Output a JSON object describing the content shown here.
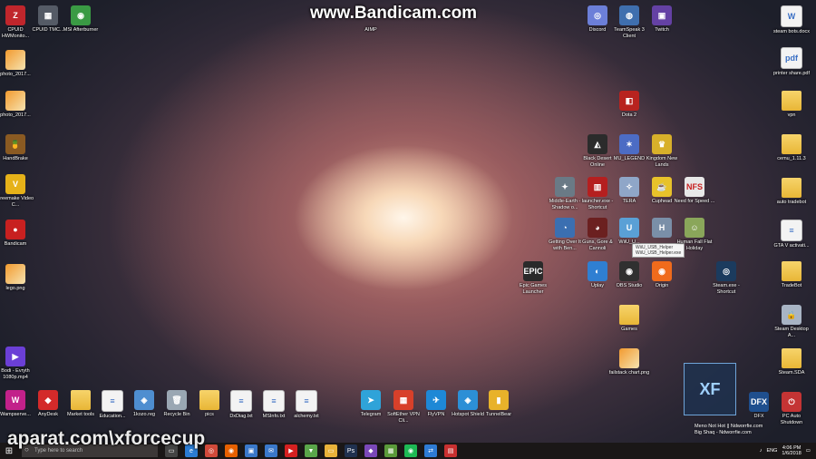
{
  "watermarks": {
    "bandicam": "www.Bandicam.com",
    "aparat": "aparat.com\\xforcecup",
    "xf": "XF"
  },
  "tooltip": {
    "line1": "WiiU_USB_Helper",
    "line2": "WiiU_USB_Helper.exe"
  },
  "desktop_icons": [
    {
      "label": "CPUID HWMonito...",
      "glyph": "Z",
      "color": "#c0262c"
    },
    {
      "label": "CPUID TMC...",
      "glyph": "▦",
      "color": "#555b66"
    },
    {
      "label": "MSI Afterburner",
      "glyph": "◉",
      "color": "#3a9a44"
    },
    {
      "label": "photo_2017...",
      "glyph": "",
      "color": "img"
    },
    {
      "label": "photo_2017...",
      "glyph": "",
      "color": "img"
    },
    {
      "label": "HandBrake",
      "glyph": "🍍",
      "color": "#8a5a22"
    },
    {
      "label": "Freemake Video C...",
      "glyph": "V",
      "color": "#e6b219"
    },
    {
      "label": "Bandicam",
      "glyph": "●",
      "color": "#c82020"
    },
    {
      "label": "lego.png",
      "glyph": "",
      "color": "img"
    },
    {
      "label": "Bodi - Evryth 1080p.mp4",
      "glyph": "▶",
      "color": "#6b3fd6"
    },
    {
      "label": "Wampserve...",
      "glyph": "W",
      "color": "#c2218a"
    },
    {
      "label": "AnyDesk",
      "glyph": "◆",
      "color": "#d32a2a"
    },
    {
      "label": "Market tools",
      "glyph": "",
      "color": "folder"
    },
    {
      "label": "Education...",
      "glyph": "≡",
      "color": "doc"
    },
    {
      "label": "1kozo.reg",
      "glyph": "◈",
      "color": "#4e8ed0"
    },
    {
      "label": "Recycle Bin",
      "glyph": "🗑",
      "color": "#9aa7b3"
    },
    {
      "label": "pics",
      "glyph": "",
      "color": "folder"
    },
    {
      "label": "DxDiag.txt",
      "glyph": "≡",
      "color": "doc"
    },
    {
      "label": "MSInfo.txt",
      "glyph": "≡",
      "color": "doc"
    },
    {
      "label": "alchemy.txt",
      "glyph": "≡",
      "color": "doc"
    },
    {
      "label": "AIMP",
      "glyph": "",
      "color": "none"
    },
    {
      "label": "Telegram",
      "glyph": "➤",
      "color": "#2fa3d9"
    },
    {
      "label": "SoftEther VPN Cli...",
      "glyph": "▦",
      "color": "#d8402a"
    },
    {
      "label": "FlyVPN",
      "glyph": "✈",
      "color": "#1e88d6"
    },
    {
      "label": "Hotspot Shield",
      "glyph": "◈",
      "color": "#2c8fd6"
    },
    {
      "label": "TunnelBear",
      "glyph": "▮",
      "color": "#e8b22a"
    },
    {
      "label": "Discord",
      "glyph": "◎",
      "color": "#6c7fd8"
    },
    {
      "label": "TeamSpeak 3 Client",
      "glyph": "◍",
      "color": "#3f6fae"
    },
    {
      "label": "Twitch",
      "glyph": "▣",
      "color": "#6441a4"
    },
    {
      "label": "Dota 2",
      "glyph": "◧",
      "color": "#b8231f"
    },
    {
      "label": "Black Desert Online",
      "glyph": "◭",
      "color": "#2b2b2b"
    },
    {
      "label": "MU_LEGEND",
      "glyph": "✶",
      "color": "#4c6cc4"
    },
    {
      "label": "Kingdom New Lands",
      "glyph": "♛",
      "color": "#d8b02a"
    },
    {
      "label": "Middle-Earth - Shadow o...",
      "glyph": "✦",
      "color": "#6a7a86"
    },
    {
      "label": "launcher.exe - Shortcut",
      "glyph": "▥",
      "color": "#b51f1f"
    },
    {
      "label": "TERA",
      "glyph": "✧",
      "color": "#8fa6c8"
    },
    {
      "label": "Cuphead",
      "glyph": "☕",
      "color": "#e8c22a"
    },
    {
      "label": "Need for Speed ...",
      "glyph": "NFS",
      "color": "#e8e8e8"
    },
    {
      "label": "Getting Over It with Ben...",
      "glyph": "◔",
      "color": "#3b6fb1"
    },
    {
      "label": "Guns, Gore & Cannoli",
      "glyph": "◕",
      "color": "#6b2020"
    },
    {
      "label": "WiiU_U...",
      "glyph": "U",
      "color": "#5aa0d6"
    },
    {
      "label": "",
      "glyph": "H",
      "color": "#7a8fa8"
    },
    {
      "label": "Human Fall Flat Holiday",
      "glyph": "☺",
      "color": "#8aa65a"
    },
    {
      "label": "Epic Games Launcher",
      "glyph": "EPIC",
      "color": "#2a2a2a"
    },
    {
      "label": "Uplay",
      "glyph": "◐",
      "color": "#2f7fd2"
    },
    {
      "label": "OBS Studio",
      "glyph": "◉",
      "color": "#303030"
    },
    {
      "label": "Origin",
      "glyph": "◉",
      "color": "#f06b1c"
    },
    {
      "label": "Steam.exe - Shortcut",
      "glyph": "◎",
      "color": "#1b3b5e"
    },
    {
      "label": "Games",
      "glyph": "",
      "color": "folder"
    },
    {
      "label": "failstack chart.png",
      "glyph": "",
      "color": "img"
    },
    {
      "label": "DFX",
      "glyph": "DFX",
      "color": "#1f4f8e"
    },
    {
      "label": "PC Auto Shutdown",
      "glyph": "⏻",
      "color": "#c43434"
    },
    {
      "label": "steam bots.docx",
      "glyph": "W",
      "color": "doc"
    },
    {
      "label": "printer share.pdf",
      "glyph": "pdf",
      "color": "doc"
    },
    {
      "label": "vpn",
      "glyph": "",
      "color": "folder"
    },
    {
      "label": "cemu_1.11.3",
      "glyph": "",
      "color": "folder"
    },
    {
      "label": "auto tradebot",
      "glyph": "",
      "color": "folder"
    },
    {
      "label": "GTA V activati...",
      "glyph": "≡",
      "color": "doc"
    },
    {
      "label": "TradeBot",
      "glyph": "",
      "color": "folder"
    },
    {
      "label": "Steam Desktop A...",
      "glyph": "🔒",
      "color": "#a8b4c4"
    },
    {
      "label": "Steam.SDA",
      "glyph": "",
      "color": "folder"
    }
  ],
  "notification": {
    "line1": "Meno Not Hot || Ndworrfie.com",
    "line2": "Big Shaq - Ndworrfie.com"
  },
  "taskbar": {
    "search_placeholder": "Type here to search",
    "apps": [
      {
        "name": "task-view-icon",
        "glyph": "▭",
        "color": "#444"
      },
      {
        "name": "edge-icon",
        "glyph": "e",
        "color": "#2b7cd3"
      },
      {
        "name": "chrome-icon",
        "glyph": "◎",
        "color": "#d04a3a"
      },
      {
        "name": "firefox-icon",
        "glyph": "◉",
        "color": "#e66000"
      },
      {
        "name": "store-icon",
        "glyph": "▣",
        "color": "#3a78c9"
      },
      {
        "name": "mail-icon",
        "glyph": "✉",
        "color": "#3a78c9"
      },
      {
        "name": "youtube-icon",
        "glyph": "▶",
        "color": "#d42020"
      },
      {
        "name": "vegas-icon",
        "glyph": "▼",
        "color": "#5aa64a"
      },
      {
        "name": "explorer-icon",
        "glyph": "▭",
        "color": "#e8b23a"
      },
      {
        "name": "photoshop-icon",
        "glyph": "Ps",
        "color": "#20314f"
      },
      {
        "name": "vs-icon",
        "glyph": "◆",
        "color": "#7a48b8"
      },
      {
        "name": "minecraft-icon",
        "glyph": "▦",
        "color": "#5a9a3a"
      },
      {
        "name": "spotify-icon",
        "glyph": "◉",
        "color": "#1db954"
      },
      {
        "name": "teamviewer-icon",
        "glyph": "⇄",
        "color": "#2e7bd4"
      },
      {
        "name": "pdf-icon",
        "glyph": "▤",
        "color": "#c83030"
      }
    ],
    "tray": {
      "lang": "ENG",
      "time": "4:06 PM",
      "date": "1/6/2018"
    }
  }
}
